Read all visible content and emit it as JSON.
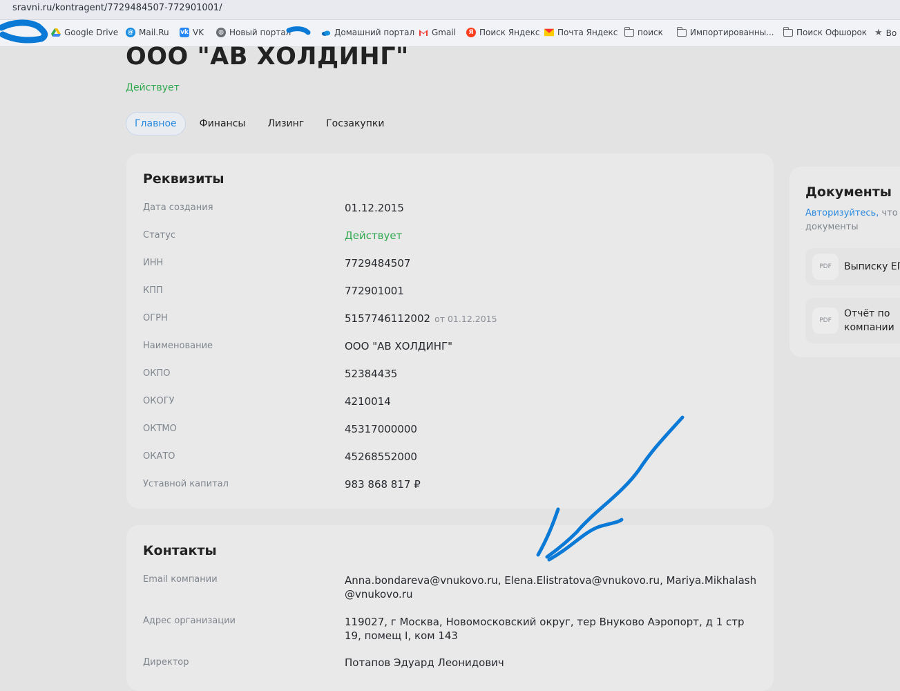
{
  "browser": {
    "url": "sravni.ru/kontragent/7729484507-772901001/",
    "bookmarks": [
      {
        "label": "Google Drive",
        "icon": "google-drive-icon"
      },
      {
        "label": "Mail.Ru",
        "icon": "mailru-icon"
      },
      {
        "label": "VK",
        "icon": "vk-icon"
      },
      {
        "label": "Новый портал",
        "icon": "globe-icon"
      },
      {
        "label": "Домашний портал",
        "icon": "cloud-icon"
      },
      {
        "label": "Gmail",
        "icon": "gmail-icon"
      },
      {
        "label": "Поиск Яндекс",
        "icon": "yandex-icon"
      },
      {
        "label": "Почта Яндекс",
        "icon": "yandex-mail-icon"
      },
      {
        "label": "поиск",
        "icon": "folder-icon"
      },
      {
        "label": "Импортированны...",
        "icon": "folder-icon"
      },
      {
        "label": "Поиск Офшорок",
        "icon": "folder-icon"
      },
      {
        "label": "Во",
        "icon": "star-icon"
      }
    ]
  },
  "company": {
    "name": "ООО \"АВ ХОЛДИНГ\"",
    "status": "Действует"
  },
  "tabs": [
    "Главное",
    "Финансы",
    "Лизинг",
    "Госзакупки"
  ],
  "requisites": {
    "title": "Реквизиты",
    "rows": [
      {
        "label": "Дата создания",
        "value": "01.12.2015"
      },
      {
        "label": "Статус",
        "value": "Действует"
      },
      {
        "label": "ИНН",
        "value": "7729484507"
      },
      {
        "label": "КПП",
        "value": "772901001"
      },
      {
        "label": "ОГРН",
        "value": "5157746112002",
        "sub": "от 01.12.2015"
      },
      {
        "label": "Наименование",
        "value": "ООО \"АВ ХОЛДИНГ\""
      },
      {
        "label": "ОКПО",
        "value": "52384435"
      },
      {
        "label": "ОКОГУ",
        "value": "4210014"
      },
      {
        "label": "ОКТМО",
        "value": "45317000000"
      },
      {
        "label": "ОКАТО",
        "value": "45268552000"
      },
      {
        "label": "Уставной капитал",
        "value": "983 868 817 ₽"
      }
    ]
  },
  "contacts": {
    "title": "Контакты",
    "rows": [
      {
        "label": "Email компании",
        "value": "Anna.bondareva@vnukovo.ru, Elena.Elistratova@vnukovo.ru, Mariya.Mikhalash @vnukovo.ru"
      },
      {
        "label": "Адрес организации",
        "value": "119027, г Москва, Новомосковский округ, тер Внуково Аэропорт, д 1 стр 19, помещ I, ком 143"
      },
      {
        "label": "Директор",
        "value": "Потапов Эдуард Леонидович"
      }
    ]
  },
  "documents": {
    "title": "Документы",
    "auth_link": "Авторизуйтесь,",
    "auth_rest": "что",
    "auth_line2": "документы",
    "items": [
      {
        "badge": "PDF",
        "label": "Выписку ЕГ"
      },
      {
        "badge": "PDF",
        "label": "Отчёт по компании"
      }
    ]
  },
  "colors": {
    "accent": "#2a8ae0",
    "status_green": "#2fa84f",
    "scribble": "#0a7ad6"
  }
}
